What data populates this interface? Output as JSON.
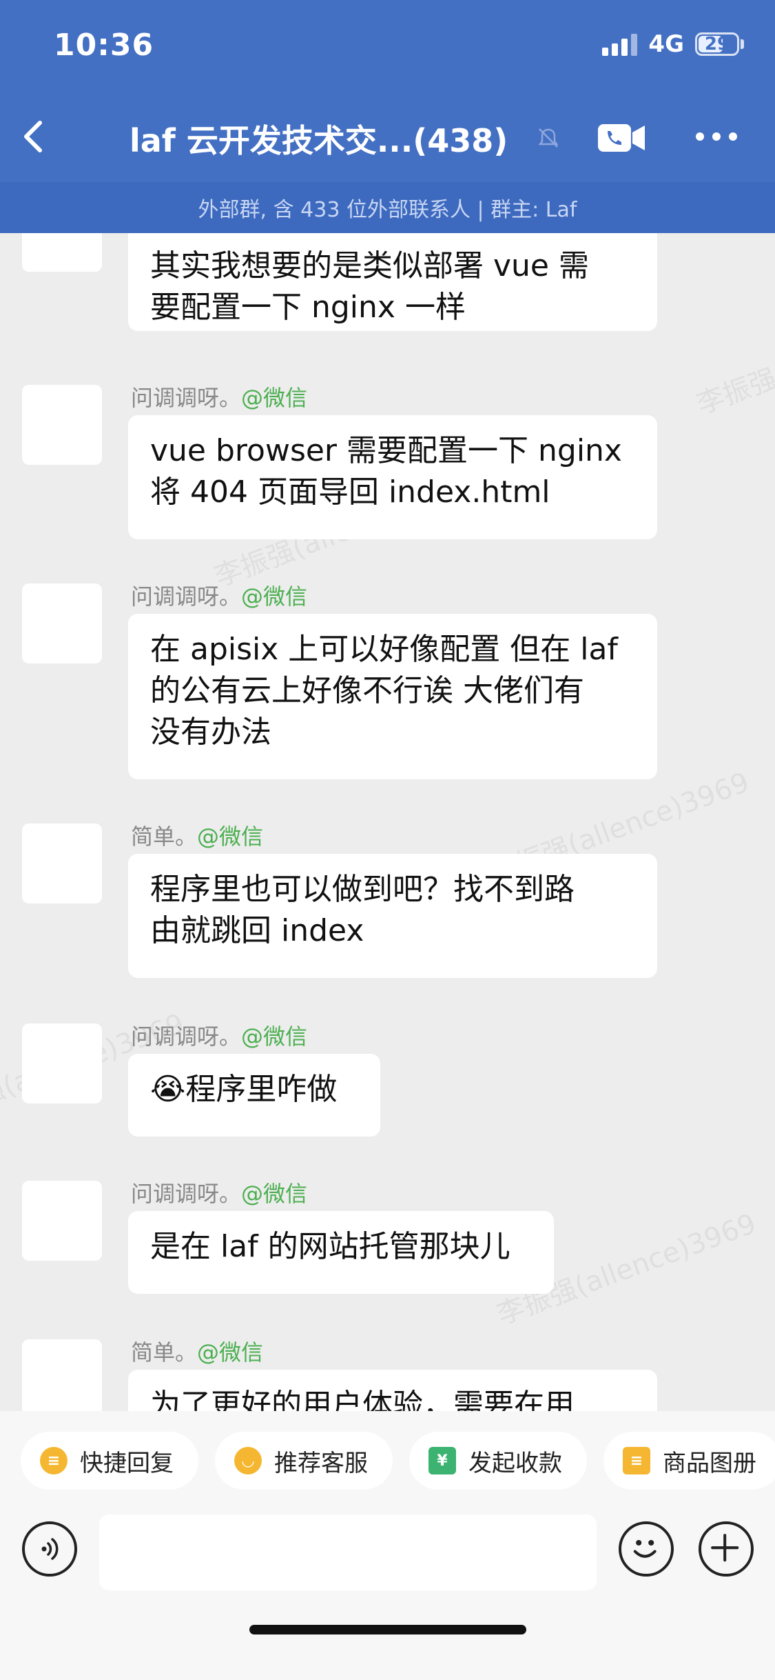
{
  "status_bar": {
    "time": "10:36",
    "network": "4G",
    "battery": "29"
  },
  "header": {
    "title": "laf 云开发技术交...(438)"
  },
  "subbar": {
    "text": "外部群, 含 433 位外部联系人 | 群主: Laf"
  },
  "watermark": {
    "text": "李振强(allence)3969"
  },
  "messages": [
    {
      "sender": "",
      "source": "",
      "lines": [
        "其实我想要的是类似部署 vue 需",
        "要配置一下 nginx 一样"
      ],
      "avatar": "cat-avatar"
    },
    {
      "sender": "问调调呀。",
      "source": "@微信",
      "lines": [
        "vue browser 需要配置一下 nginx",
        "将 404 页面导回 index.html"
      ],
      "avatar": "cat-avatar"
    },
    {
      "sender": "问调调呀。",
      "source": "@微信",
      "lines": [
        "在 apisix 上可以好像配置 但在 laf",
        "的公有云上好像不行诶 大佬们有",
        "没有办法"
      ],
      "avatar": "cat-avatar"
    },
    {
      "sender": "简单。",
      "source": "@微信",
      "lines": [
        "程序里也可以做到吧？找不到路",
        "由就跳回 index"
      ],
      "avatar": "robot-avatar"
    },
    {
      "sender": "问调调呀。",
      "source": "@微信",
      "lines": [
        "😭程序里咋做"
      ],
      "avatar": "cat-avatar"
    },
    {
      "sender": "问调调呀。",
      "source": "@微信",
      "lines": [
        "是在 laf 的网站托管那块儿"
      ],
      "avatar": "cat-avatar"
    },
    {
      "sender": "简单。",
      "source": "@微信",
      "lines": [
        "为了更好的用户体验，需要在用"
      ],
      "avatar": "robot-avatar"
    }
  ],
  "quick_actions": [
    {
      "label": "快捷回复",
      "icon": "quick-reply-icon",
      "color": "#f5b731"
    },
    {
      "label": "推荐客服",
      "icon": "service-icon",
      "color": "#f5b731"
    },
    {
      "label": "发起收款",
      "icon": "payment-icon",
      "color": "#3cb371",
      "glyph": "¥"
    },
    {
      "label": "商品图册",
      "icon": "catalog-icon",
      "color": "#f5b731"
    }
  ],
  "colors": {
    "header": "#4470c4",
    "subbar": "#3d69bf",
    "source": "#4caf50"
  }
}
